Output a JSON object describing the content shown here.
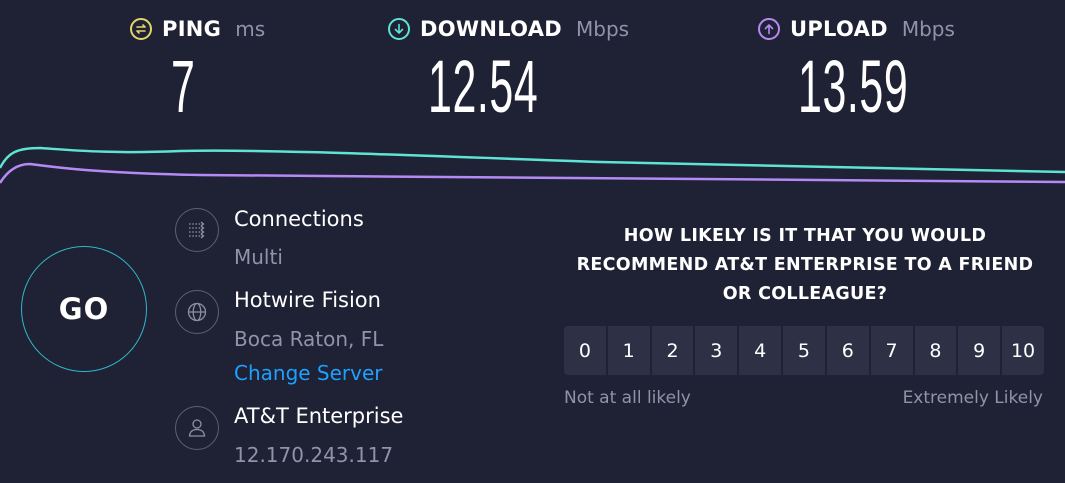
{
  "metrics": {
    "ping": {
      "label": "PING",
      "unit": "ms",
      "value": "7",
      "icon": "ping-icon",
      "color": "#e5d56b"
    },
    "download": {
      "label": "DOWNLOAD",
      "unit": "Mbps",
      "value": "12.54",
      "icon": "download-arrow-icon",
      "color": "#5ee3d5"
    },
    "upload": {
      "label": "UPLOAD",
      "unit": "Mbps",
      "value": "13.59",
      "icon": "upload-arrow-icon",
      "color": "#b68af4"
    }
  },
  "go_label": "GO",
  "connections": {
    "title": "Connections",
    "value": "Multi",
    "icon": "connections-icon"
  },
  "server": {
    "title": "Hotwire Fision",
    "location": "Boca Raton, FL",
    "change_label": "Change Server",
    "icon": "globe-icon"
  },
  "provider": {
    "title": "AT&T Enterprise",
    "ip": "12.170.243.117",
    "icon": "user-icon"
  },
  "survey": {
    "question": "HOW LIKELY IS IT THAT YOU WOULD RECOMMEND AT&T ENTERPRISE TO A FRIEND OR COLLEAGUE?",
    "options": [
      "0",
      "1",
      "2",
      "3",
      "4",
      "5",
      "6",
      "7",
      "8",
      "9",
      "10"
    ],
    "low_label": "Not at all likely",
    "high_label": "Extremely Likely"
  },
  "colors": {
    "background": "#1f2134",
    "accent_link": "#1ea0ff",
    "go_ring": "#2fb9c8",
    "download_line": "#5ee3d5",
    "upload_line": "#b68af4"
  }
}
